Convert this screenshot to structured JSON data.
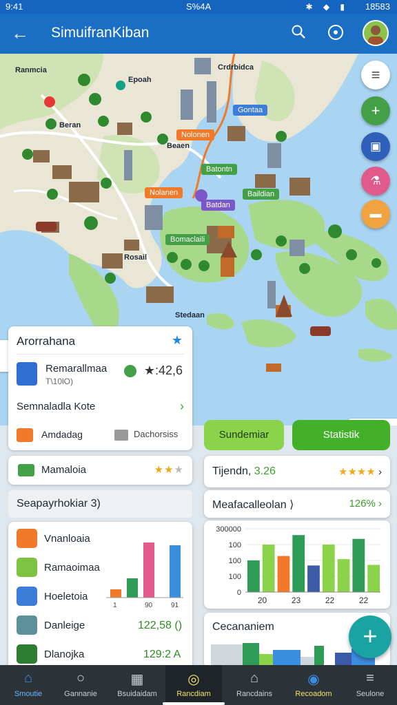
{
  "status": {
    "time": "9:41",
    "center": "S%4A",
    "right": "18583",
    "icons": "✱ ◆ ▮"
  },
  "appbar": {
    "title": "SimuifranKiban",
    "back_icon": "arrow-left-icon",
    "search_icon": "search-icon",
    "compass_icon": "compass-icon"
  },
  "map": {
    "labels": [
      "Ranmcia",
      "Epoah",
      "Crdrbidca",
      "Beran",
      "Beaen",
      "Stedaan",
      "Rosail"
    ],
    "tags": {
      "t1": "Gontaa",
      "t2": "Nolonen",
      "t3": "Batontn",
      "t4": "Nolanen",
      "t5": "Baildian",
      "t6": "Batdan",
      "t7": "Bomaclaili"
    }
  },
  "side_fabs": [
    "menu-icon",
    "add-icon",
    "calendar-icon",
    "flask-icon",
    "bed-icon"
  ],
  "info_card": {
    "title": "Arorrahana",
    "place": "Remarallmaa",
    "place_sub": "T\\10lO)",
    "rating": "★:42,6",
    "city": "Semnaladla Kote",
    "action1": "Amdadag",
    "action2": "Dachorsiss"
  },
  "buttons": {
    "left": "Sundemiar",
    "right": "Statistik"
  },
  "left_row": {
    "label": "Mamaloia",
    "stars": "★★",
    "stars_off": "★"
  },
  "right_row": {
    "label": "Tijendn,",
    "value": "3.26",
    "stars": "★★★★",
    "chev": "›"
  },
  "section_title": "Seapayrhokiar 3)",
  "right_row2": {
    "label": "Meafacalleolan ⟩",
    "value": "126% ›"
  },
  "list": [
    {
      "label": "Vnanloaia",
      "color": "#f07a2a"
    },
    {
      "label": "Ramaoimaa",
      "color": "#43a047"
    },
    {
      "label": "Hoeletoia",
      "color": "#3b7dd8"
    },
    {
      "label": "Danleige",
      "color": "#5b8f9a",
      "value": "122,58 ()"
    },
    {
      "label": "Dlanojka",
      "color": "#2e7d32",
      "value": "129:2 A"
    }
  ],
  "mini_chart_ticks": [
    "1",
    "90",
    "91"
  ],
  "chart_data": {
    "type": "bar",
    "title": "",
    "categories": [
      "20",
      "23",
      "22",
      "22"
    ],
    "yticks": [
      "300000",
      "100",
      "100",
      "100",
      "0"
    ],
    "series": [
      {
        "values": [
          50,
          75,
          57,
          90,
          42,
          75,
          52,
          84,
          43
        ]
      }
    ],
    "colors": [
      "#2e9b57",
      "#8bd34a",
      "#f07a2a",
      "#2e9b57",
      "#3d5aa8",
      "#8bd34a",
      "#8bd34a",
      "#2e9b57",
      "#8bd34a"
    ],
    "ylim": [
      0,
      100
    ]
  },
  "bottom_card": {
    "title": "Cecananiem"
  },
  "nav": [
    {
      "label": "Smoutie",
      "icon": "home-icon"
    },
    {
      "label": "Gannanie",
      "icon": "search-icon"
    },
    {
      "label": "Bsuidaidam",
      "icon": "building-icon"
    },
    {
      "label": "Rancdiam",
      "icon": "compass-icon"
    },
    {
      "label": "Rancdains",
      "icon": "house-icon"
    },
    {
      "label": "Recoadom",
      "icon": "clock-icon"
    },
    {
      "label": "Seulone",
      "icon": "menu-icon"
    }
  ]
}
